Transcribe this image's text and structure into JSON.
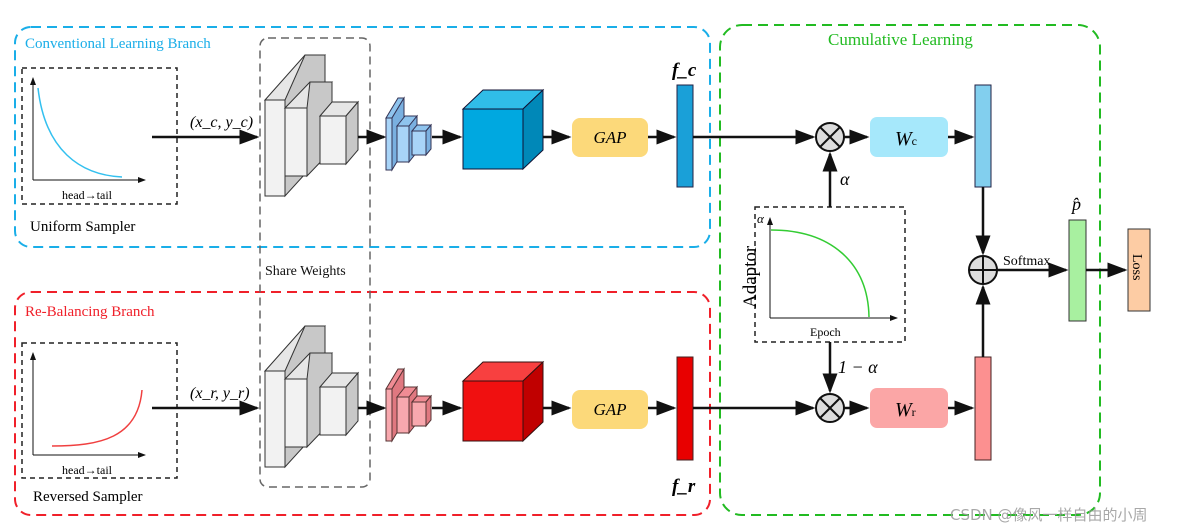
{
  "branches": {
    "conventional": {
      "title": "Conventional Learning Branch",
      "sampler": "Uniform Sampler",
      "axis_label": "head→tail",
      "input": "(x_c, y_c)",
      "feature": "f_c",
      "color": "#1aaee8"
    },
    "rebalancing": {
      "title": "Re-Balancing Branch",
      "sampler": "Reversed Sampler",
      "axis_label": "head→tail",
      "input": "(x_r, y_r)",
      "feature": "f_r",
      "color": "#f0202a"
    }
  },
  "share_weights": "Share Weights",
  "gap_label": "GAP",
  "cumulative": {
    "title": "Cumulative Learning",
    "color": "#22bb22",
    "adaptor": "Adaptor",
    "adaptor_axis_x": "Epoch",
    "adaptor_axis_y": "α",
    "alpha": "α",
    "one_minus_alpha": "1 − α",
    "wc": "W",
    "wc_sub": "c",
    "wr": "W",
    "wr_sub": "r",
    "softmax": "Softmax",
    "p_hat": "p̂",
    "loss": "Loss"
  },
  "watermark": "CSDN @像风一样自由的小周"
}
